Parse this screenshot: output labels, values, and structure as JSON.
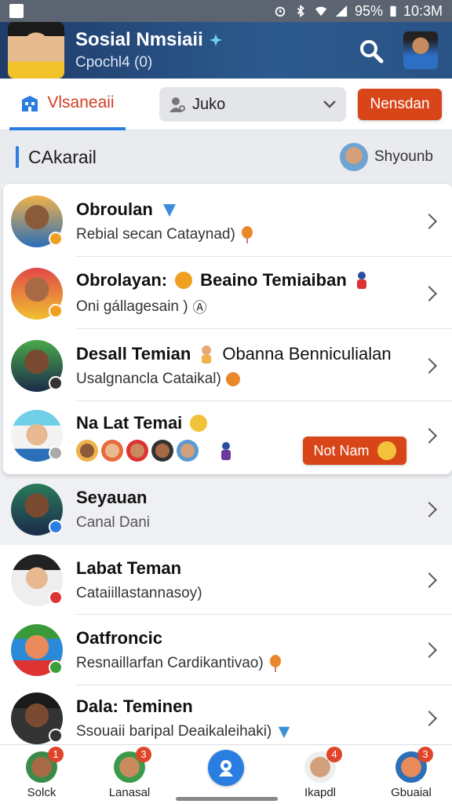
{
  "status_bar": {
    "battery": "95%",
    "time": "10:3M"
  },
  "header": {
    "title": "Sosial Nmsiaii",
    "subtitle": "Cpochl4 (0)"
  },
  "toolbar": {
    "tab_label": "Vlsaneaii",
    "dropdown_value": "Juko",
    "send_label": "Nensdan"
  },
  "section": {
    "title": "CAkarail",
    "user_name": "Shyounb"
  },
  "rows": [
    {
      "name": "Obroulan",
      "name_extra": "",
      "sub": "Rebial secan Cataynad)",
      "dot_color": "#f0a020"
    },
    {
      "name": "Obrolayan:",
      "name_extra": "Beaino Temiaiban",
      "sub": "Oni gállagesain )",
      "dot_color": "#f0a020"
    },
    {
      "name": "Desall Temian",
      "name_extra": "Obanna Benniculialan",
      "sub": "Usalgnancla Cataikal)",
      "dot_color": "#333"
    },
    {
      "name": "Na Lat Temai",
      "name_extra": "",
      "sub": "",
      "dot_color": "#999"
    },
    {
      "name": "Seyauan",
      "name_extra": "",
      "sub": "Canal Dani",
      "dot_color": "#2a7de1"
    },
    {
      "name": "Labat Teman",
      "name_extra": "",
      "sub": "Cataiillastannasoy)",
      "dot_color": "#d33"
    },
    {
      "name": "Oatfroncic",
      "name_extra": "",
      "sub": "Resnaillarfan Cardikantivao)",
      "dot_color": "#3aa03a"
    },
    {
      "name": "Dala: Teminen",
      "name_extra": "",
      "sub": "Ssouaii baripal Deaikaleihaki)",
      "dot_color": "#333"
    }
  ],
  "notnam_label": "Not Nam",
  "bottom_nav": [
    {
      "label": "Solck",
      "count": "1"
    },
    {
      "label": "Lanasal",
      "count": "3"
    },
    {
      "label": "Ikapdl",
      "count": "4"
    },
    {
      "label": "Gbuaial",
      "count": "3"
    }
  ]
}
